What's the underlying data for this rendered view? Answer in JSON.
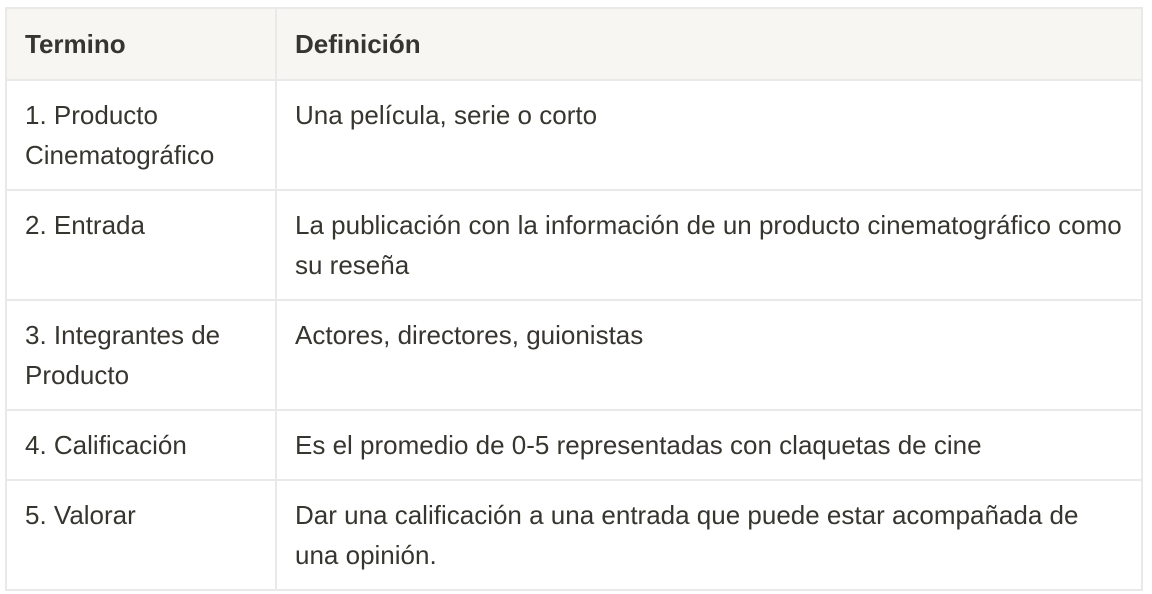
{
  "table": {
    "headers": [
      "Termino",
      "Definición"
    ],
    "rows": [
      {
        "term": "1. Producto Cinematográfico",
        "definition": "Una película, serie o corto"
      },
      {
        "term": "2. Entrada",
        "definition": "La publicación con la información de un producto cinematográfico como su reseña"
      },
      {
        "term": "3. Integrantes de Producto",
        "definition": "Actores, directores, guionistas"
      },
      {
        "term": "4. Calificación",
        "definition": "Es el promedio de 0-5 representadas con claquetas de cine"
      },
      {
        "term": "5. Valorar",
        "definition": "Dar una calificación a una entrada que puede estar acompañada de una opinión."
      }
    ]
  },
  "colors": {
    "header_bg": "#f7f6f3",
    "border": "#e9e9e7",
    "text": "#37352f"
  }
}
